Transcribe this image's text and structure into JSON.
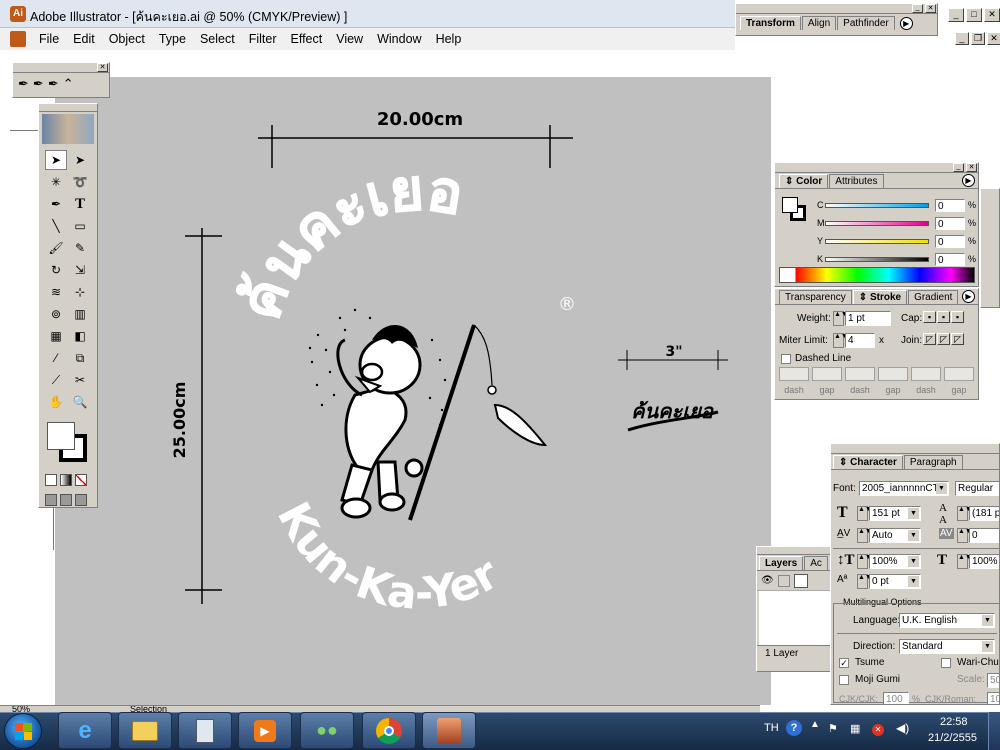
{
  "window": {
    "title": "Adobe Illustrator - [ค้นคะเยอ.ai @ 50% (CMYK/Preview) ]"
  },
  "menu": [
    "File",
    "Edit",
    "Object",
    "Type",
    "Select",
    "Filter",
    "Effect",
    "View",
    "Window",
    "Help"
  ],
  "canvas": {
    "dim_width": "20.00cm",
    "dim_height": "25.00cm",
    "dim_small": "3\"",
    "logo_thai": "ค้นคะเยอ",
    "logo_en": "Kun-Ka-Yer",
    "registered": "®",
    "small_logo": "ค้นคะเยอ"
  },
  "transform_panel": {
    "tabs": [
      "Transform",
      "Align",
      "Pathfinder"
    ]
  },
  "color_panel": {
    "tabs": [
      "Color",
      "Attributes"
    ],
    "channels": [
      {
        "label": "C",
        "value": "0",
        "unit": "%",
        "color": "#00a0e0"
      },
      {
        "label": "M",
        "value": "0",
        "unit": "%",
        "color": "#e0008c"
      },
      {
        "label": "Y",
        "value": "0",
        "unit": "%",
        "color": "#f0e000"
      },
      {
        "label": "K",
        "value": "0",
        "unit": "%",
        "color": "#000000"
      }
    ]
  },
  "stroke_panel": {
    "tabs": [
      "Transparency",
      "Stroke",
      "Gradient"
    ],
    "weight_label": "Weight:",
    "weight_value": "1 pt",
    "cap_label": "Cap:",
    "miter_label": "Miter Limit:",
    "miter_value": "4",
    "miter_x": "x",
    "join_label": "Join:",
    "dashed_label": "Dashed Line",
    "dash_labels": [
      "dash",
      "gap",
      "dash",
      "gap",
      "dash",
      "gap"
    ]
  },
  "character_panel": {
    "tabs": [
      "Character",
      "Paragraph"
    ],
    "font_label": "Font:",
    "font_value": "2005_iannnnnCT",
    "style_value": "Regular",
    "size": "151 pt",
    "leading": "(181 p",
    "kerning": "Auto",
    "tracking": "0",
    "vscale": "100%",
    "hscale": "100%",
    "baseline": "0 pt",
    "multilingual": "Multilingual Options",
    "language_label": "Language:",
    "language_value": "U.K. English",
    "direction_label": "Direction:",
    "direction_value": "Standard",
    "tsume": "Tsume",
    "wari": "Wari-Chu",
    "moji": "Moji Gumi",
    "scale_label": "Scale:",
    "scale_value": "50",
    "cjk_label": "CJK/CJK:",
    "cjk_value": "100",
    "cjk_unit": "%",
    "cjk_roman_label": "CJK/Roman:",
    "cjk_roman_value": "10"
  },
  "layers_panel": {
    "tabs": [
      "Layers",
      "Ac"
    ],
    "count": "1 Layer"
  },
  "status": {
    "zoom": "50%",
    "tool": "Selection"
  },
  "taskbar": {
    "lang": "TH",
    "time": "22:58",
    "date": "21/2/2555"
  }
}
